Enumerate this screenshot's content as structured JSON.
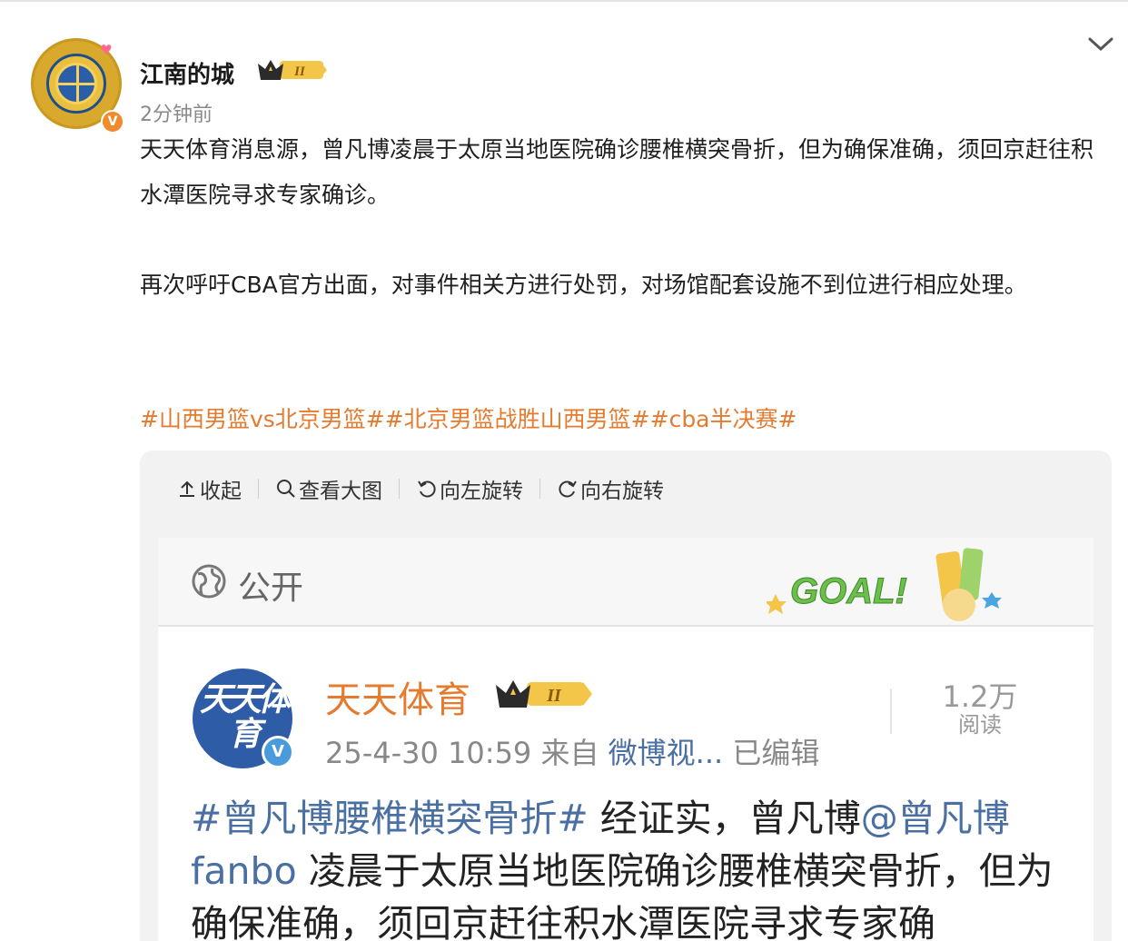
{
  "post": {
    "username": "江南的城",
    "level_badge": "II",
    "timestamp": "2分钟前",
    "paragraph1": "天天体育消息源，曾凡博凌晨于太原当地医院确诊腰椎横突骨折，但为确保准确，须回京赶往积水潭医院寻求专家确诊。",
    "paragraph2": "再次呼吁CBA官方出面，对事件相关方进行处罚，对场馆配套设施不到位进行相应处理。",
    "hashtags": [
      "#山西男篮vs北京男篮#",
      "#北京男篮战胜山西男篮#",
      "#cba半决赛#"
    ]
  },
  "image_toolbar": {
    "collapse": "收起",
    "view_large": "查看大图",
    "rotate_left": "向左旋转",
    "rotate_right": "向右旋转"
  },
  "embedded": {
    "visibility": "公开",
    "sticker_text": "GOAL!",
    "avatar_text": "天天体育",
    "source_name": "天天体育",
    "level_badge": "II",
    "date": "25-4-30 10:59",
    "from_label": "来自",
    "from_source": "微博视...",
    "edited": "已编辑",
    "reads_count": "1.2万",
    "reads_label": "阅读",
    "text_hashtag": "#曾凡博腰椎横突骨折#",
    "text_part1": " 经证实，曾凡博",
    "text_mention": "@曾凡博fanbo",
    "text_part2": " 凌晨于太原当地医院确诊腰椎横突骨折，但为确保准确，须回京赶往积水潭医院寻求专家确"
  },
  "colors": {
    "accent_orange": "#e57b2f",
    "link_blue": "#4a6fa3",
    "verified_orange": "#f08a2c",
    "verified_blue": "#4a9bdc"
  }
}
